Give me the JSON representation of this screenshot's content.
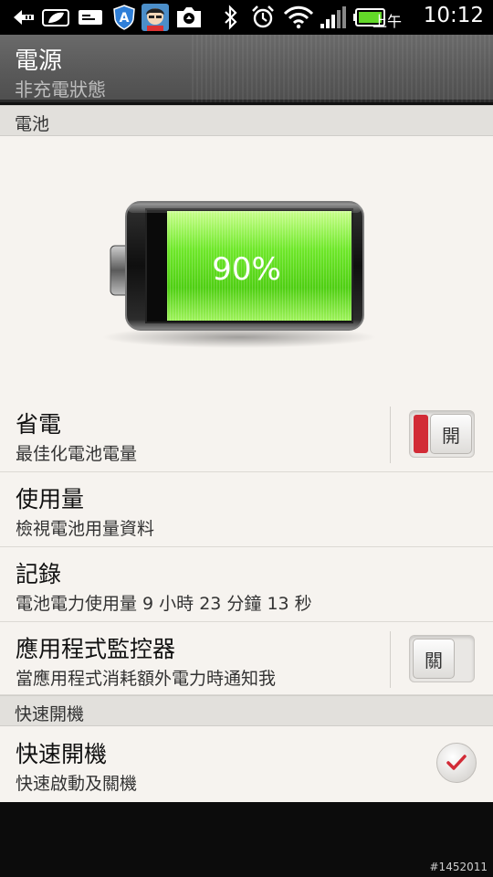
{
  "status_bar": {
    "ampm": "上午",
    "time": "10:12",
    "icons": [
      "back-arrow-icon",
      "leaf-icon",
      "card-icon",
      "shield-a-icon",
      "avatar-app-icon",
      "camera-icon",
      "bluetooth-icon",
      "alarm-icon",
      "wifi-icon",
      "signal-icon",
      "battery-icon"
    ]
  },
  "header": {
    "title": "電源",
    "subtitle": "非充電狀態"
  },
  "battery_section": {
    "header": "電池",
    "percent": "90%",
    "level": 0.9
  },
  "settings": [
    {
      "title": "省電",
      "subtitle": "最佳化電池電量",
      "control": "toggle",
      "state_label": "開",
      "on": true
    },
    {
      "title": "使用量",
      "subtitle": "檢視電池用量資料"
    },
    {
      "title": "記錄",
      "subtitle": "電池電力使用量 9 小時 23 分鐘 13 秒"
    },
    {
      "title": "應用程式監控器",
      "subtitle": "當應用程式消耗額外電力時通知我",
      "control": "toggle",
      "state_label": "關",
      "on": false
    }
  ],
  "fast_boot_section": {
    "header": "快速開機",
    "item": {
      "title": "快速開機",
      "subtitle": "快速啟動及關機",
      "checked": true
    }
  },
  "watermark": "#1452011",
  "colors": {
    "accent_red": "#d22b36",
    "battery_green": "#5fe21f"
  }
}
